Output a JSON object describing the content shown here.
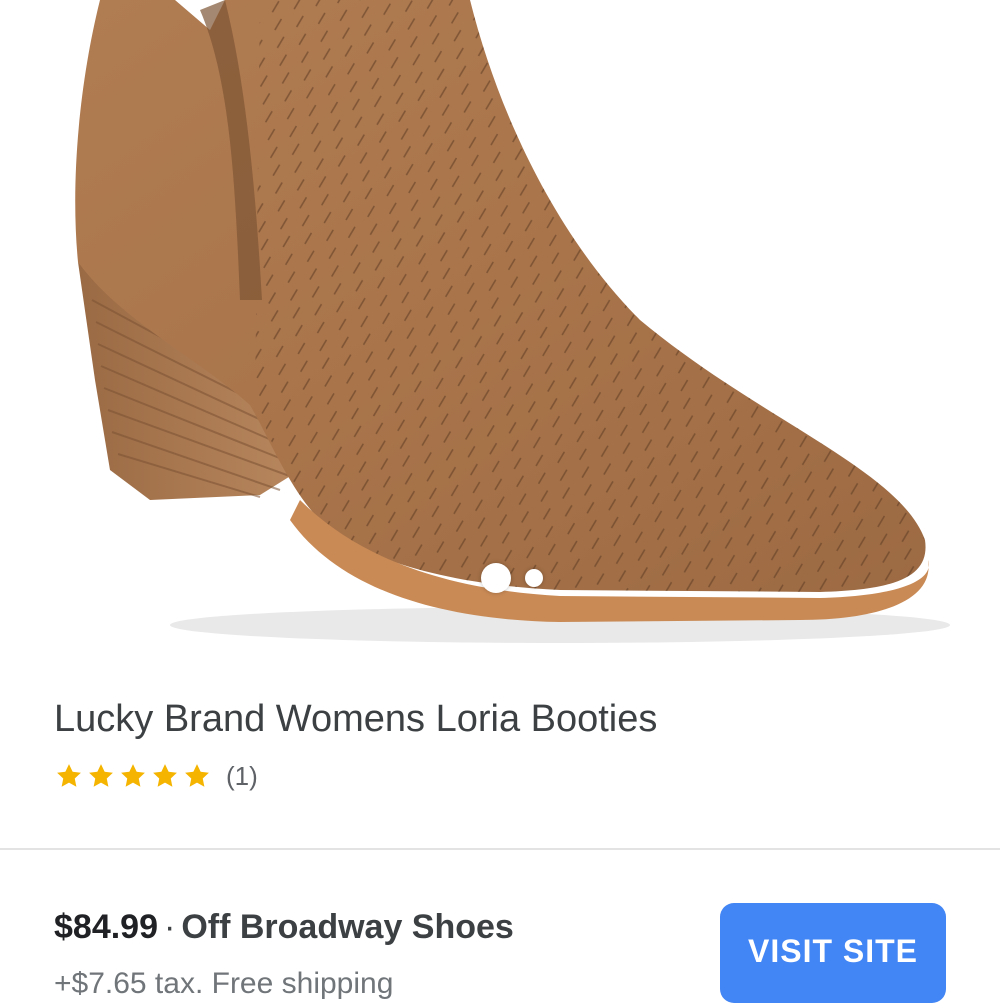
{
  "product": {
    "image_alt": "Brown suede ankle bootie",
    "title": "Lucky Brand Womens Loria Booties",
    "rating_stars": 5,
    "rating_count": "(1)",
    "star_color": "#f4b400"
  },
  "carousel": {
    "total": 2,
    "active_index": 0
  },
  "offer": {
    "price": "$84.99",
    "separator": "·",
    "store": "Off Broadway Shoes",
    "details": "+$7.65 tax. Free shipping",
    "button_label": "VISIT SITE",
    "button_color": "#4285f4"
  }
}
